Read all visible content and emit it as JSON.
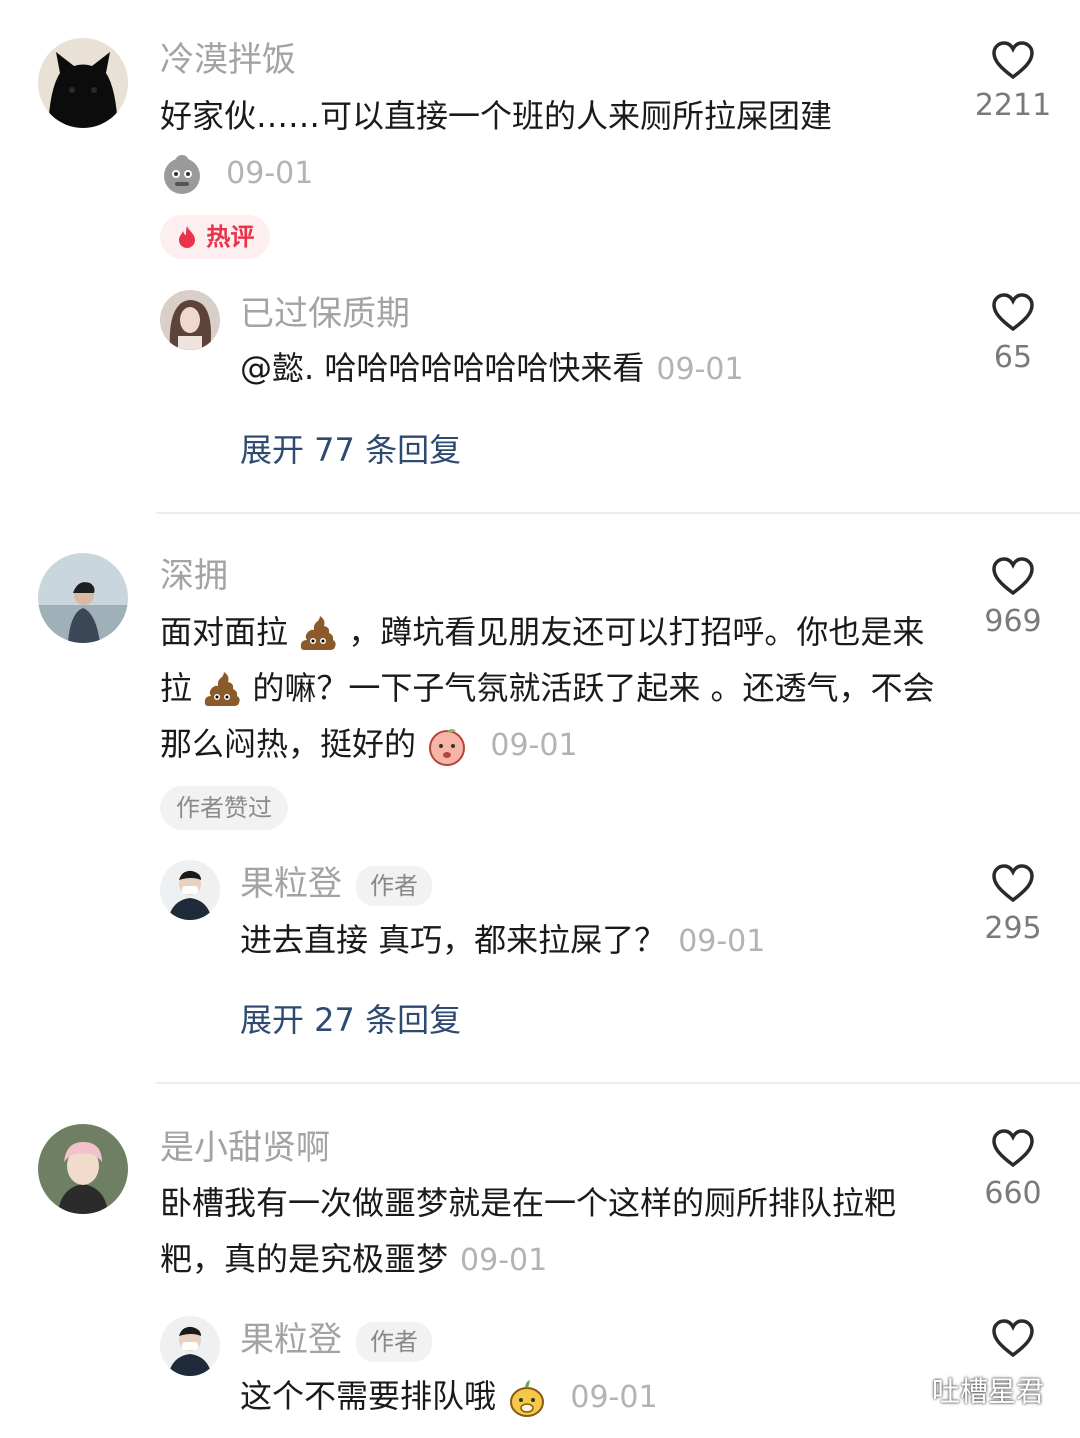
{
  "comments": [
    {
      "username": "冷漠拌饭",
      "text": "好家伙……可以直接一个班的人来厕所拉屎团建",
      "date": "09-01",
      "likes": "2211",
      "tag": "热评",
      "reply": {
        "username": "已过保质期",
        "text": "@懿. 哈哈哈哈哈哈哈快来看",
        "date": "09-01",
        "likes": "65"
      },
      "expand": "展开 77 条回复"
    },
    {
      "username": "深拥",
      "text_parts": [
        "面对面拉",
        "，蹲坑看见朋友还可以打招呼。你也是来拉",
        "的嘛？一下子气氛就活跃了起来 。还透气，不会那么闷热，挺好的"
      ],
      "date": "09-01",
      "likes": "969",
      "tag": "作者赞过",
      "reply": {
        "username": "果粒登",
        "badge": "作者",
        "text": "进去直接 真巧，都来拉屎了？",
        "date": "09-01",
        "likes": "295"
      },
      "expand": "展开 27 条回复"
    },
    {
      "username": "是小甜贤啊",
      "text": "卧槽我有一次做噩梦就是在一个这样的厕所排队拉粑粑，真的是究极噩梦",
      "date": "09-01",
      "likes": "660",
      "reply": {
        "username": "果粒登",
        "badge": "作者",
        "text": "这个不需要排队哦",
        "date": "09-01"
      }
    }
  ],
  "watermark": "吐槽星君",
  "icons": [
    "heart-icon",
    "fire-icon",
    "poop-emoji",
    "wechat-icon"
  ]
}
